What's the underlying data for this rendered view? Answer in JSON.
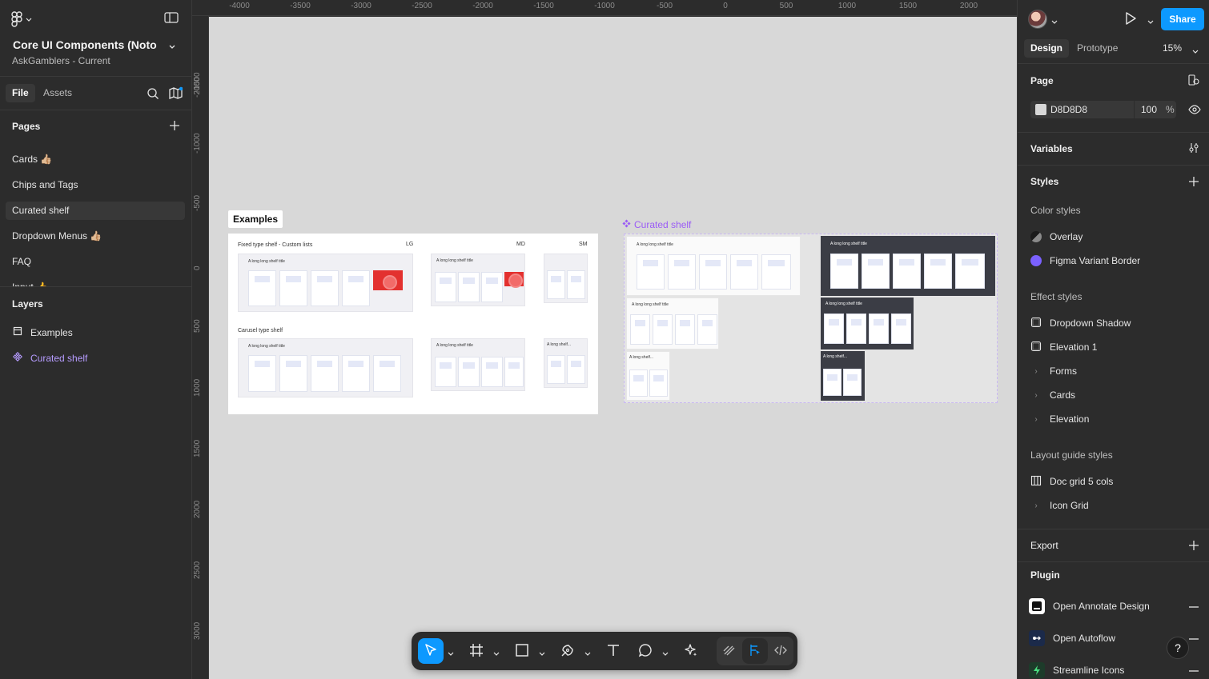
{
  "file": {
    "title": "Core UI Components (Noto...",
    "subtitle": "AskGamblers - Current"
  },
  "left_tabs": {
    "file": "File",
    "assets": "Assets"
  },
  "pages": {
    "heading": "Pages",
    "items": [
      "Cards 👍🏼",
      "Chips and Tags",
      "Curated shelf",
      "Dropdown Menus 👍🏼",
      "FAQ",
      "Input 👍"
    ]
  },
  "layers": {
    "heading": "Layers",
    "items": [
      "Examples",
      "Curated shelf"
    ]
  },
  "ruler": {
    "top": [
      "-4000",
      "-3500",
      "-3000",
      "-2500",
      "-2000",
      "-1500",
      "-1000",
      "-500",
      "0",
      "500",
      "1000",
      "1500",
      "2000"
    ],
    "left": [
      "-2000",
      "-1500",
      "-1000",
      "-500",
      "0",
      "500",
      "1000",
      "1500",
      "2000",
      "2500",
      "3000"
    ]
  },
  "canvas": {
    "background": "#D8D8D8",
    "examples_label": "Examples",
    "examples": {
      "fixed_title": "Fixed type shelf - Custom lists",
      "carousel_title": "Carusel type shelf",
      "size_lg": "LG",
      "size_md": "MD",
      "size_sm": "SM",
      "shelf_title": "A long long shelf title",
      "shelf_title_short": "A long shelf..."
    },
    "curated_label": "Curated shelf"
  },
  "right": {
    "share": "Share",
    "tabs": {
      "design": "Design",
      "prototype": "Prototype"
    },
    "zoom": "15%",
    "page": {
      "heading": "Page",
      "color": "D8D8D8",
      "opacity": "100",
      "percent": "%"
    },
    "variables": "Variables",
    "styles": {
      "heading": "Styles",
      "color_styles": "Color styles",
      "colors": [
        {
          "name": "Overlay",
          "color": "#4a4a4a"
        },
        {
          "name": "Figma Variant Border",
          "color": "#7b61ff"
        }
      ],
      "effect_styles": "Effect styles",
      "effects": [
        "Dropdown Shadow",
        "Elevation 1"
      ],
      "effect_groups": [
        "Forms",
        "Cards",
        "Elevation"
      ],
      "layout_styles": "Layout guide styles",
      "layouts": [
        "Doc grid 5 cols"
      ],
      "layout_groups": [
        "Icon Grid"
      ]
    },
    "export": "Export",
    "plugin": {
      "heading": "Plugin",
      "items": [
        "Open Annotate Design",
        "Open Autoflow",
        "Streamline Icons"
      ]
    },
    "help": "?"
  },
  "colors": {
    "accent": "#0d99ff",
    "purple": "#9b5cf6"
  }
}
